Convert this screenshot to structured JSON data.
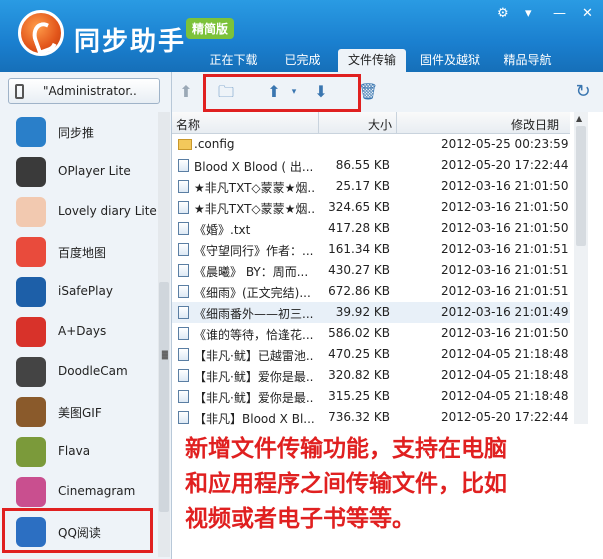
{
  "header": {
    "app_title": "同步助手",
    "edition": "精简版",
    "tabs": [
      {
        "label": "正在下载",
        "active": false
      },
      {
        "label": "已完成",
        "active": false
      },
      {
        "label": "文件传输",
        "active": true
      },
      {
        "label": "固件及越狱",
        "active": false
      },
      {
        "label": "精品导航",
        "active": false
      }
    ]
  },
  "sidebar": {
    "device_name": "\"Administrator..",
    "apps": [
      {
        "label": "同步推",
        "icon": "tongbutui-icon",
        "color": "#2a7fc9"
      },
      {
        "label": "OPlayer Lite",
        "icon": "oplayer-icon",
        "color": "#3a3a3a"
      },
      {
        "label": "Lovely diary Lite",
        "icon": "lovely-diary-icon",
        "color": "#f2c9b0"
      },
      {
        "label": "百度地图",
        "icon": "baidu-map-icon",
        "color": "#e94b3c"
      },
      {
        "label": "iSafePlay",
        "icon": "isafeplay-icon",
        "color": "#1d5fa8"
      },
      {
        "label": "A+Days",
        "icon": "adays-icon",
        "color": "#d8322a"
      },
      {
        "label": "DoodleCam",
        "icon": "doodlecam-icon",
        "color": "#444444"
      },
      {
        "label": "美图GIF",
        "icon": "meitu-gif-icon",
        "color": "#8a5a2b"
      },
      {
        "label": "Flava",
        "icon": "flava-icon",
        "color": "#7b9a3a"
      },
      {
        "label": "Cinemagram",
        "icon": "cinemagram-icon",
        "color": "#c94f8f"
      },
      {
        "label": "QQ阅读",
        "icon": "qq-reader-icon",
        "color": "#2c6fc2"
      }
    ]
  },
  "toolbar": {
    "buttons": [
      "back-arrow-icon",
      "new-folder-icon",
      "upload-icon",
      "download-icon",
      "delete-icon",
      "refresh-icon"
    ]
  },
  "filelist": {
    "columns": {
      "name": "名称",
      "size": "大小",
      "date": "修改日期"
    },
    "rows": [
      {
        "name": ".config",
        "size": "",
        "date": "2012-05-25 00:23:59",
        "folder": true
      },
      {
        "name": "Blood X Blood ( 出...",
        "size": "86.55 KB",
        "date": "2012-05-20 17:22:44"
      },
      {
        "name": "★非凡TXT◇蒙蒙★烟...",
        "size": "25.17 KB",
        "date": "2012-03-16 21:01:50"
      },
      {
        "name": "★非凡TXT◇蒙蒙★烟...",
        "size": "324.65 KB",
        "date": "2012-03-16 21:01:50"
      },
      {
        "name": "《婚》.txt",
        "size": "417.28 KB",
        "date": "2012-03-16 21:01:50"
      },
      {
        "name": "《守望同行》作者：...",
        "size": "161.34 KB",
        "date": "2012-03-16 21:01:51"
      },
      {
        "name": "《晨曦》 BY：周而...",
        "size": "430.27 KB",
        "date": "2012-03-16 21:01:51"
      },
      {
        "name": "《细雨》(正文完结)...",
        "size": "672.86 KB",
        "date": "2012-03-16 21:01:51"
      },
      {
        "name": "《细雨番外——初三...",
        "size": "39.92 KB",
        "date": "2012-03-16 21:01:49",
        "selected": true
      },
      {
        "name": "《谁的等待，恰逢花...",
        "size": "586.02 KB",
        "date": "2012-03-16 21:01:50"
      },
      {
        "name": "【非凡·鱿】已越雷池...",
        "size": "470.25 KB",
        "date": "2012-04-05 21:18:48"
      },
      {
        "name": "【非凡·鱿】爱你是最...",
        "size": "320.82 KB",
        "date": "2012-04-05 21:18:48"
      },
      {
        "name": "【非凡·鱿】爱你是最...",
        "size": "315.25 KB",
        "date": "2012-04-05 21:18:48"
      },
      {
        "name": "【非凡】Blood X Bl...",
        "size": "736.32 KB",
        "date": "2012-05-20 17:22:44"
      }
    ]
  },
  "caption": {
    "line1": "新增文件传输功能，支持在电脑",
    "line2": "和应用程序之间传输文件，比如",
    "line3": "视频或者电子书等等。"
  },
  "colors": {
    "header_blue": "#1a7fcf",
    "highlight_red": "#e02020",
    "edition_green": "#7cc23a"
  }
}
